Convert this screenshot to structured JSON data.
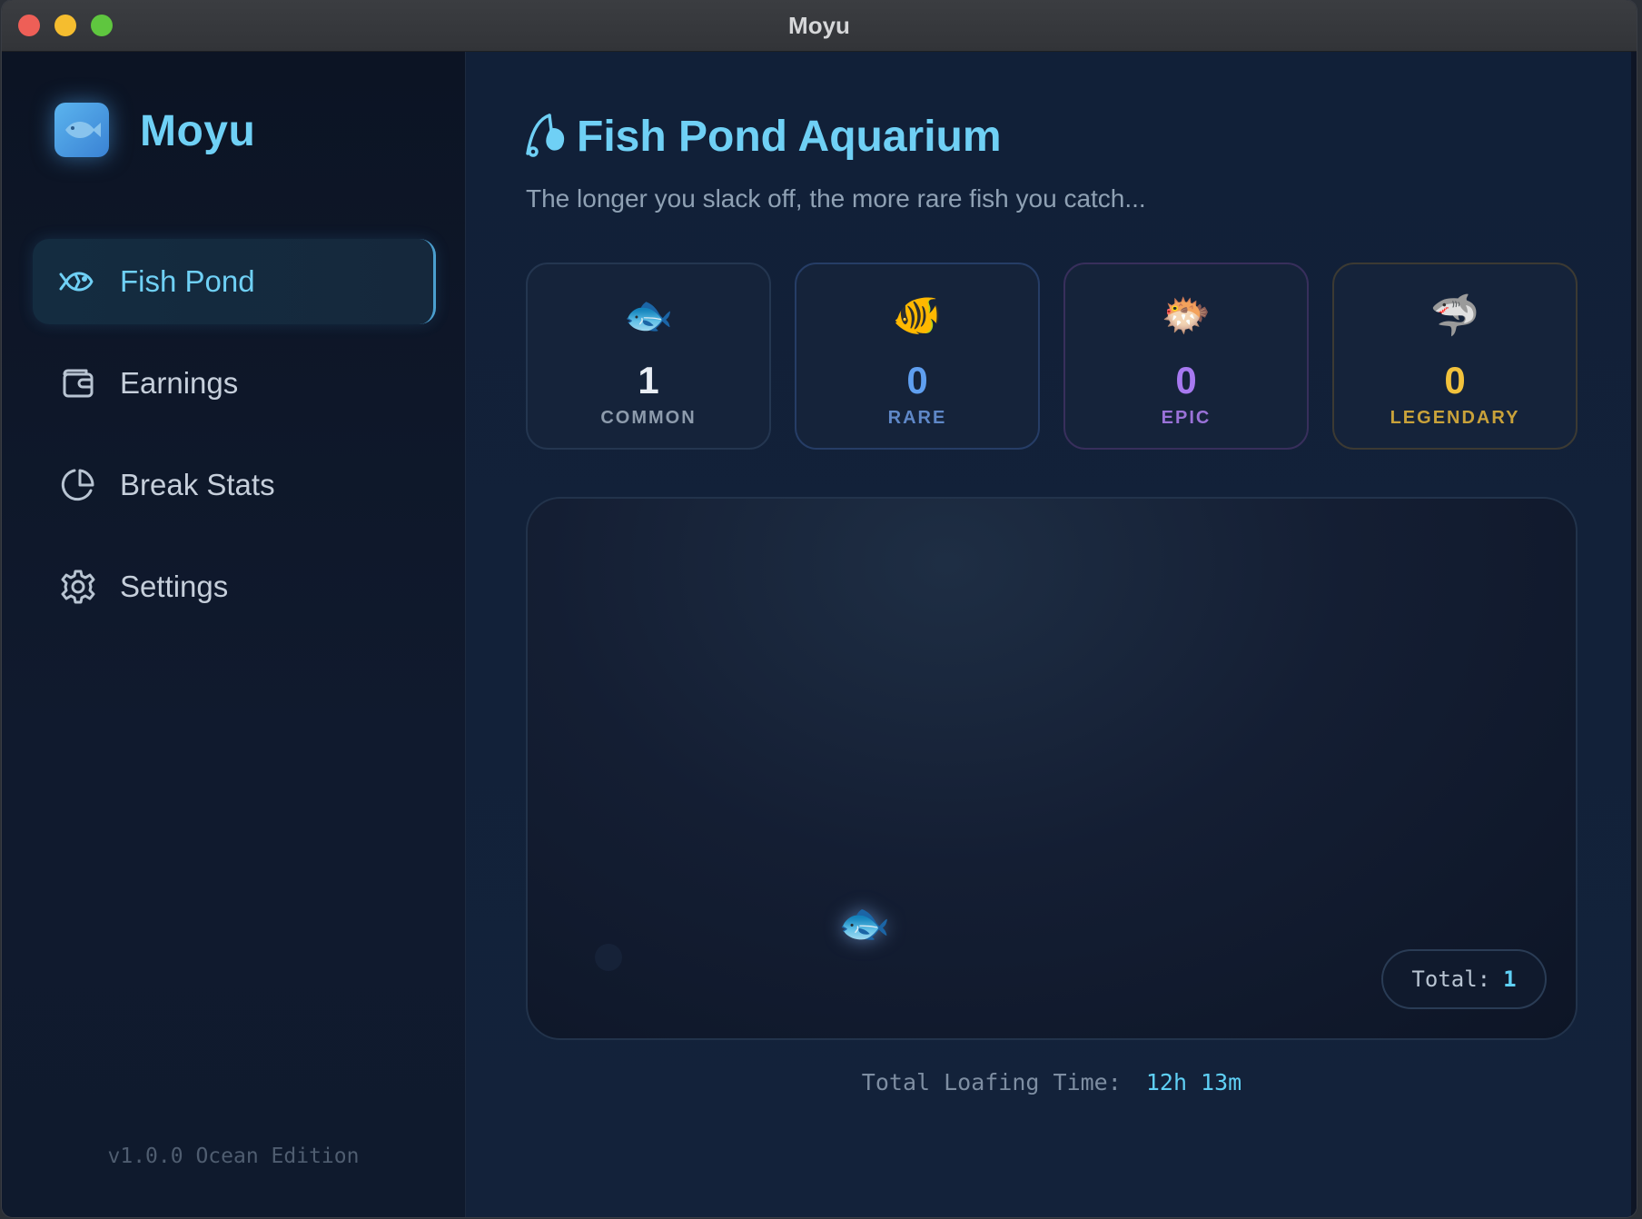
{
  "window": {
    "title": "Moyu"
  },
  "sidebar": {
    "brand": "Moyu",
    "brand_icon": "fish-icon",
    "items": [
      {
        "label": "Fish Pond",
        "icon": "fish-icon",
        "active": true
      },
      {
        "label": "Earnings",
        "icon": "wallet-icon",
        "active": false
      },
      {
        "label": "Break Stats",
        "icon": "pie-chart-icon",
        "active": false
      },
      {
        "label": "Settings",
        "icon": "gear-icon",
        "active": false
      }
    ],
    "version": "v1.0.0 Ocean Edition"
  },
  "main": {
    "title": "Fish Pond Aquarium",
    "title_icon": "fishing-rod-icon",
    "subtitle": "The longer you slack off, the more rare fish you catch...",
    "stats": [
      {
        "emoji": "🐟",
        "count": "1",
        "label": "COMMON",
        "color": "#e9eef5",
        "label_color": "#8d9bac",
        "border": "#243650"
      },
      {
        "emoji": "🐠",
        "count": "0",
        "label": "RARE",
        "color": "#5f9ff0",
        "label_color": "#5f88c8",
        "border": "#263d66"
      },
      {
        "emoji": "🐡",
        "count": "0",
        "label": "EPIC",
        "color": "#a779f0",
        "label_color": "#9a72d8",
        "border": "#382f5c"
      },
      {
        "emoji": "🦈",
        "count": "0",
        "label": "LEGENDARY",
        "color": "#f2c23c",
        "label_color": "#c9a23a",
        "border": "#3c3a33"
      }
    ],
    "pond": {
      "fish": "🐟",
      "total_label": "Total:",
      "total_value": "1"
    },
    "loafing": {
      "label": "Total Loafing Time:",
      "value": "12h 13m"
    }
  },
  "colors": {
    "accent": "#6fd0f5",
    "background": "#112038"
  }
}
